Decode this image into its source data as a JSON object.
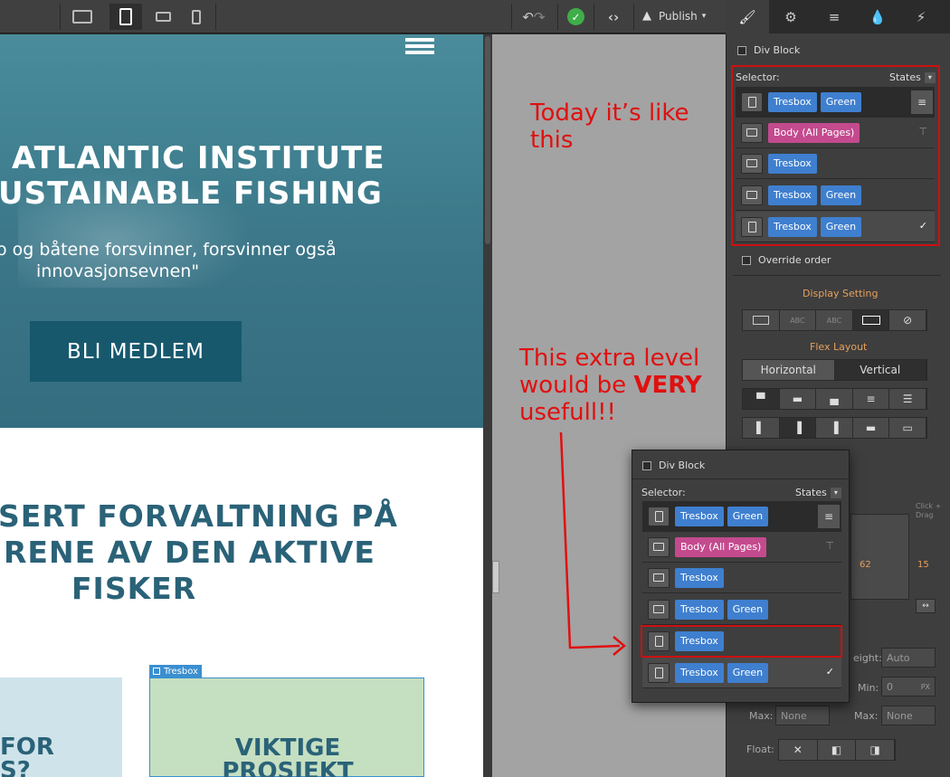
{
  "toolbar": {
    "publish_label": "Publish"
  },
  "hero": {
    "title_line1": "ATLANTIC INSTITUTE",
    "title_line2": "USTAINABLE FISHING",
    "quote_line1": "o og båtene forsvinner, forsvinner også",
    "quote_line2": "innovasjonsevnen\"",
    "cta_label": "BLI MEDLEM"
  },
  "section2": {
    "line1": "SERT FORVALTNING PÅ",
    "line2": "RENE AV DEN AKTIVE",
    "line3": "FISKER"
  },
  "cards": {
    "card1_line1": "FOR",
    "card1_line2": "S?",
    "card2_tag": "Tresbox",
    "card2_line1": "VIKTIGE",
    "card2_line2": "PROSJEKT"
  },
  "panel": {
    "element_type": "Div Block",
    "selector_label": "Selector:",
    "states_label": "States",
    "classes": {
      "tresbox": "Tresbox",
      "green": "Green",
      "body": "Body (All Pages)"
    },
    "override_label": "Override order",
    "display_setting": "Display Setting",
    "display_abc1": "ABC",
    "display_abc2": "ABC",
    "flex_layout": "Flex Layout",
    "flex_horizontal": "Horizontal",
    "flex_vertical": "Vertical",
    "height_label": "eight:",
    "height_value": "Auto",
    "min_label": "Min:",
    "min_value": "0",
    "min_unit": "PX",
    "max_label": "Max:",
    "max_value": "None",
    "max2_label": "Max:",
    "max2_value": "None",
    "float_label": "Float:",
    "box_value1": "62",
    "box_value2": "15",
    "drag_hint": "Click + Drag"
  },
  "annotations": {
    "note1_line1": "Today it’s like",
    "note1_line2": "this",
    "note2_line1": "This extra level",
    "note2_line2_a": "would be ",
    "note2_line2_b": "VERY",
    "note2_line3": "usefull!!"
  },
  "colors": {
    "annotation": "#e01010",
    "class_blue": "#3f7fcf",
    "class_pink": "#c44a8e"
  }
}
